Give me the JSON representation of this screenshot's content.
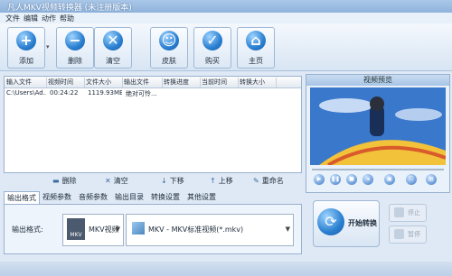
{
  "window": {
    "title": "凡人MKV视频转换器  (未注册版本)"
  },
  "menu": [
    "文件",
    "编辑",
    "动作",
    "帮助"
  ],
  "toolbar": {
    "add": "添加",
    "add_icon": "+",
    "remove": "删除",
    "remove_icon": "−",
    "clear": "清空",
    "clear_icon": "✕",
    "skin": "皮肤",
    "skin_icon": "☺",
    "buy": "购买",
    "buy_icon": "✓",
    "home": "主页",
    "home_icon": "⌂"
  },
  "list": {
    "columns": [
      "输入文件",
      "视频时间",
      "文件大小",
      "输出文件",
      "转换进度",
      "当前时间",
      "转换大小"
    ],
    "rows": [
      [
        "C:\\Users\\Ad...",
        "00:24:22",
        "1119.93MB",
        "绝对可怜...",
        "",
        "",
        ""
      ]
    ]
  },
  "list_controls": {
    "delete": "删除",
    "clear": "清空",
    "down": "下移",
    "up": "上移",
    "rename": "重命名"
  },
  "tabs": [
    "输出格式",
    "视频参数",
    "音频参数",
    "输出目录",
    "转换设置",
    "其他设置"
  ],
  "output": {
    "label": "输出格式:",
    "format": "MKV视频",
    "format_icon_text": "MKV",
    "profile": "MKV - MKV标准视频(*.mkv)"
  },
  "preview": {
    "title": "视频预览"
  },
  "actions": {
    "convert": "开始转换",
    "stop": "停止",
    "pause": "暂停"
  },
  "colors": {
    "accent": "#2a7fd0",
    "background": "#dfe9f5"
  }
}
